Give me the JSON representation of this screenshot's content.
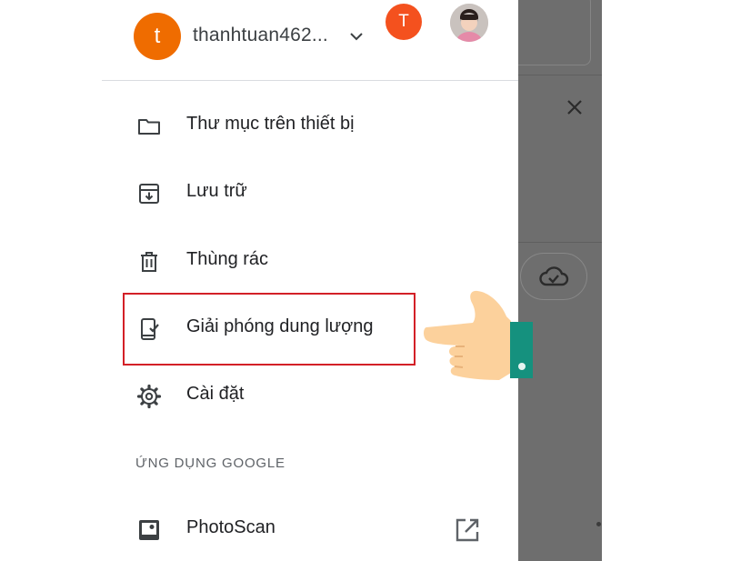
{
  "account": {
    "initial": "t",
    "name": "thanhtuan462...",
    "other_account_initial": "T"
  },
  "menu": {
    "items": [
      {
        "label": "Thư mục trên thiết bị",
        "icon": "folder-icon"
      },
      {
        "label": "Lưu trữ",
        "icon": "archive-icon"
      },
      {
        "label": "Thùng rác",
        "icon": "trash-icon"
      },
      {
        "label": "Giải phóng dung lượng",
        "icon": "phone-check-icon",
        "highlighted": true
      },
      {
        "label": "Cài đặt",
        "icon": "gear-icon"
      }
    ],
    "section_heading": "ỨNG DỤNG GOOGLE",
    "apps": [
      {
        "label": "PhotoScan",
        "icon": "photoscan-icon",
        "action_icon": "open-external-icon"
      }
    ]
  },
  "colors": {
    "accent_avatar": "#ef6c00",
    "second_avatar": "#f4511e",
    "highlight": "#d32027",
    "scrim": "#6e6e6e"
  }
}
